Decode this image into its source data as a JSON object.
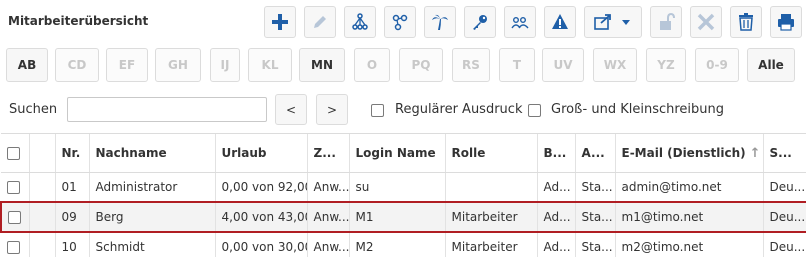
{
  "page_title": "Mitarbeiterübersicht",
  "toolbar": {
    "buttons": [
      {
        "name": "add-button",
        "icon": "plus-icon",
        "color": "#1f5fa8"
      },
      {
        "name": "edit-button",
        "icon": "pencil-icon",
        "color": "#b7c6d8"
      },
      {
        "name": "hierarchy-button",
        "icon": "org-tree-icon",
        "color": "#1f5fa8"
      },
      {
        "name": "network-button",
        "icon": "nodes-icon",
        "color": "#1f5fa8"
      },
      {
        "name": "vacation-button",
        "icon": "palm-tree-icon",
        "color": "#1f5fa8"
      },
      {
        "name": "password-button",
        "icon": "key-icon",
        "color": "#1f5fa8"
      },
      {
        "name": "groups-button",
        "icon": "users-icon",
        "color": "#1f5fa8"
      },
      {
        "name": "alert-button",
        "icon": "warning-icon",
        "color": "#1f5fa8"
      },
      {
        "name": "export-button",
        "icon": "share-dropdown-icon",
        "color": "#1f5fa8"
      },
      {
        "name": "unlock-button",
        "icon": "unlock-icon",
        "color": "#b7c6d8"
      },
      {
        "name": "delete-button",
        "icon": "close-icon",
        "color": "#b7c6d8"
      },
      {
        "name": "trash-button",
        "icon": "trash-icon",
        "color": "#1f5fa8"
      },
      {
        "name": "print-button",
        "icon": "printer-icon",
        "color": "#1f5fa8"
      }
    ]
  },
  "alphabet_filter": {
    "items": [
      "AB",
      "CD",
      "EF",
      "GH",
      "IJ",
      "KL",
      "MN",
      "O",
      "PQ",
      "RS",
      "T",
      "UV",
      "WX",
      "YZ",
      "0-9",
      "Alle"
    ],
    "active": [
      "AB",
      "MN",
      "Alle"
    ]
  },
  "search": {
    "label": "Suchen",
    "value": "",
    "prev_label": "<",
    "next_label": ">",
    "regex_label": "Regulärer Ausdruck",
    "case_label": "Groß- und Kleinschreibung"
  },
  "table": {
    "columns": [
      "Nr.",
      "Nachname",
      "Urlaub",
      "Z...",
      "Login Name",
      "Rolle",
      "B...",
      "A...",
      "E-Mail (Dienstlich)",
      "S..."
    ],
    "sorted_column_icon": "sort-asc-icon",
    "rows": [
      {
        "nr": "01",
        "nachname": "Administrator",
        "urlaub": "0,00 von 92,00",
        "z": "Anw...",
        "login": "su",
        "rolle": "",
        "b": "Ad...",
        "a": "Sta...",
        "email": "admin@timo.net",
        "s": "Deu..."
      },
      {
        "nr": "09",
        "nachname": "Berg",
        "urlaub": "4,00 von 43,00",
        "z": "Anw...",
        "login": "M1",
        "rolle": "Mitarbeiter",
        "b": "Ad...",
        "a": "Sta...",
        "email": "m1@timo.net",
        "s": "Deu...",
        "selected": true
      },
      {
        "nr": "10",
        "nachname": "Schmidt",
        "urlaub": "0,00 von 30,00",
        "z": "Anw...",
        "login": "M2",
        "rolle": "Mitarbeiter",
        "b": "Ad...",
        "a": "Sta...",
        "email": "m2@timo.net",
        "s": "Deu..."
      }
    ]
  },
  "colors": {
    "accent": "#1f5fa8",
    "disabled": "#b7c6d8",
    "selection_border": "#b01e23"
  }
}
